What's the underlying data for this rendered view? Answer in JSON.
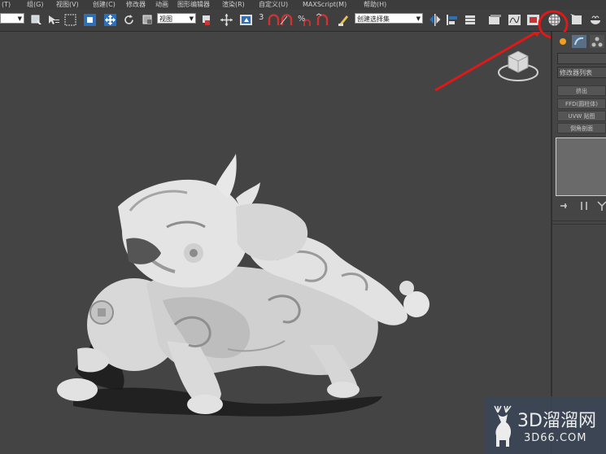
{
  "menu": [
    {
      "label": "(T)"
    },
    {
      "label": "组(G)"
    },
    {
      "label": "视图(V)"
    },
    {
      "label": "创建(C)"
    },
    {
      "label": "修改器"
    },
    {
      "label": "动画"
    },
    {
      "label": "图形编辑器"
    },
    {
      "label": "渲染(R)"
    },
    {
      "label": "自定义(U)"
    },
    {
      "label": "MAXScript(M)"
    },
    {
      "label": "帮助(H)"
    }
  ],
  "toolbar": {
    "view_dropdown": "视图",
    "selection_set_dropdown": "创建选择集",
    "snap_label": "3"
  },
  "command_panel": {
    "modifier_list_label": "修改器列表",
    "buttons": [
      {
        "label": "挤出"
      },
      {
        "label": "FFD(圆柱体)"
      },
      {
        "label": "UVW 贴图"
      },
      {
        "label": "倒角剖面"
      }
    ]
  },
  "viewport": {
    "object": "pixiu-statue-model",
    "highlight_color": "#e01818"
  },
  "watermark": {
    "line1": "3D溜溜网",
    "line2": "3D66.COM"
  }
}
